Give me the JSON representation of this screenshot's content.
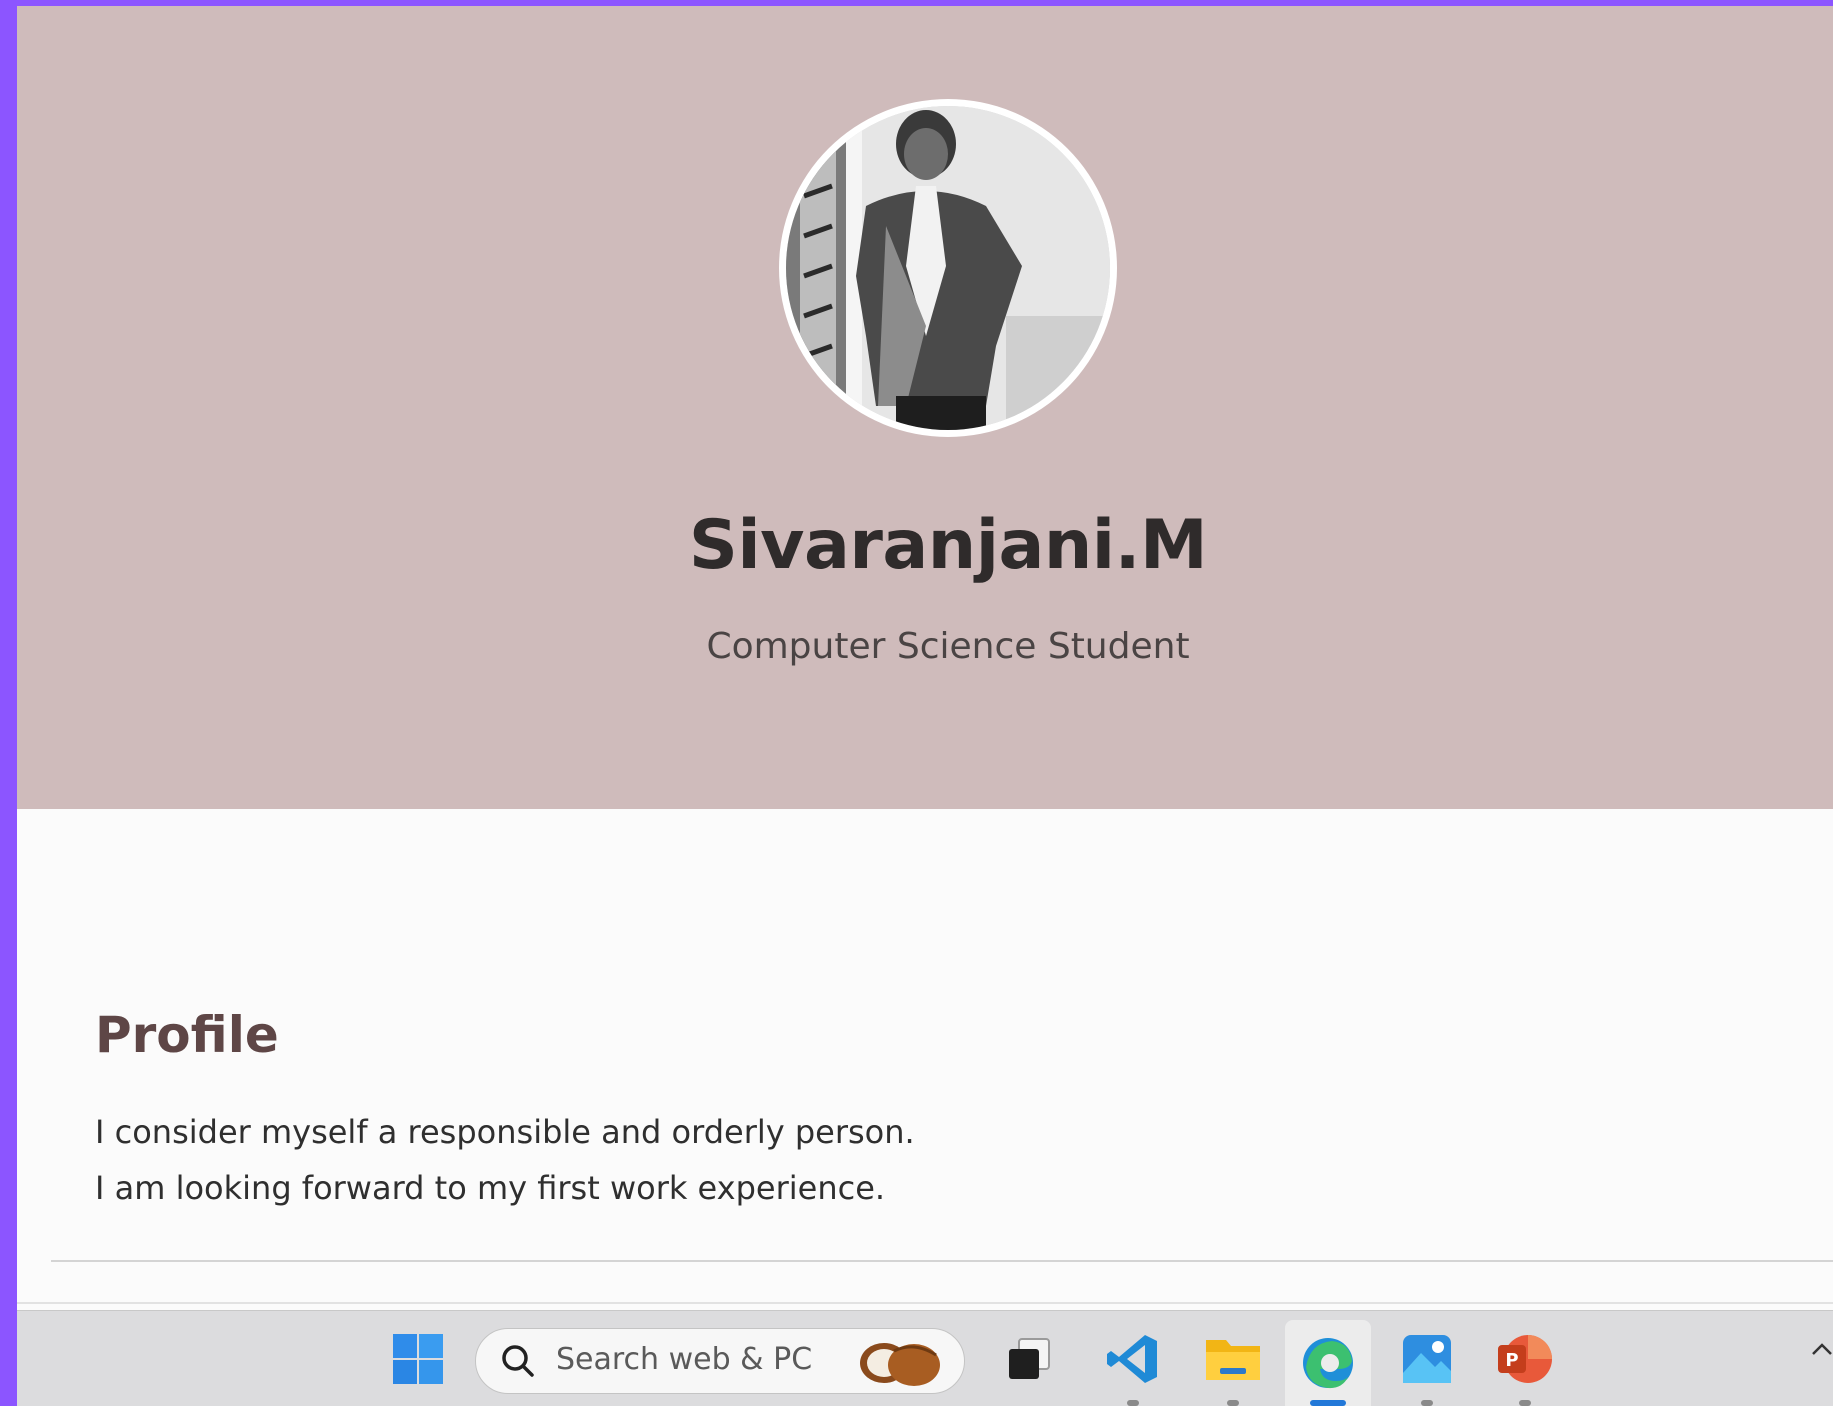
{
  "hero": {
    "name": "Sivaranjani.M",
    "role": "Computer Science Student"
  },
  "profile": {
    "title": "Profile",
    "lines": [
      "I consider myself a responsible and orderly person.",
      "I am looking forward to my first work experience."
    ]
  },
  "taskbar": {
    "search_placeholder": "Search web & PC",
    "apps": [
      "start-icon",
      "task-view-icon",
      "vscode-icon",
      "file-explorer-icon",
      "edge-icon",
      "photos-icon",
      "powerpoint-icon"
    ]
  },
  "colors": {
    "frame": "#8c55ff",
    "hero_bg": "#cfbbbb",
    "section_title": "#5e4646"
  }
}
